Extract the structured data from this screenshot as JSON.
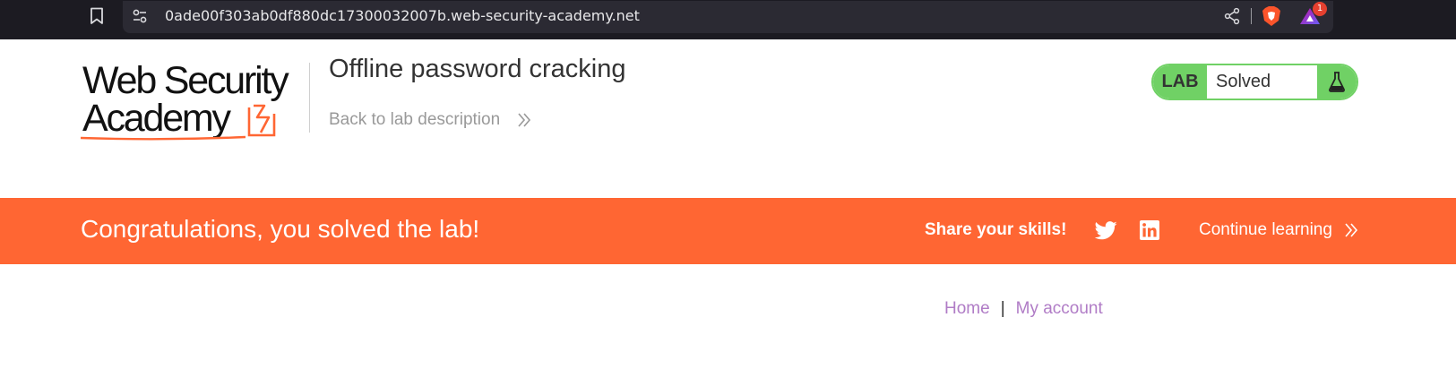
{
  "browser": {
    "url": "0ade00f303ab0df880dc17300032007b.web-security-academy.net",
    "rewards_badge_count": "1",
    "icons": [
      "bookmark-icon",
      "site-settings-icon",
      "share-icon",
      "brave-shield-icon",
      "brave-rewards-icon"
    ]
  },
  "header": {
    "logo_line1": "Web Security",
    "logo_line2": "Academy",
    "lab_title": "Offline password cracking",
    "back_link": "Back to lab description"
  },
  "lab_status": {
    "tag": "LAB",
    "status": "Solved",
    "icon": "flask-icon"
  },
  "banner": {
    "message": "Congratulations, you solved the lab!",
    "share_label": "Share your skills!",
    "continue_label": "Continue learning",
    "icons": [
      "twitter-icon",
      "linkedin-icon"
    ]
  },
  "nav": {
    "home": "Home",
    "separator": "|",
    "my_account": "My account"
  },
  "colors": {
    "banner_orange": "#ff6633",
    "status_green": "#70d165",
    "link_purple": "#b07cc6",
    "browser_bg": "#1c1b22"
  }
}
